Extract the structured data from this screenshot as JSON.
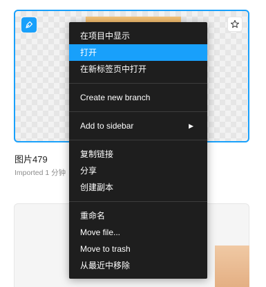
{
  "file_card": {
    "title": "图片479",
    "subtitle": "Imported 1 分钟"
  },
  "context_menu": {
    "items": [
      {
        "label": "在项目中显示"
      },
      {
        "label": "打开"
      },
      {
        "label": "在新标签页中打开"
      },
      {
        "label": "Create new branch"
      },
      {
        "label": "Add to sidebar",
        "submenu_icon": "▶"
      },
      {
        "label": "复制链接"
      },
      {
        "label": "分享"
      },
      {
        "label": "创建副本"
      },
      {
        "label": "重命名"
      },
      {
        "label": "Move file..."
      },
      {
        "label": "Move to trash"
      },
      {
        "label": "从最近中移除"
      }
    ]
  },
  "icons": {
    "file_badge": "pen-tool-icon",
    "favorite": "star-icon",
    "submenu": "chevron-right-icon"
  },
  "colors": {
    "accent": "#18a0fb",
    "menu_bg": "#1e1e1e",
    "menu_text": "#ffffff"
  }
}
